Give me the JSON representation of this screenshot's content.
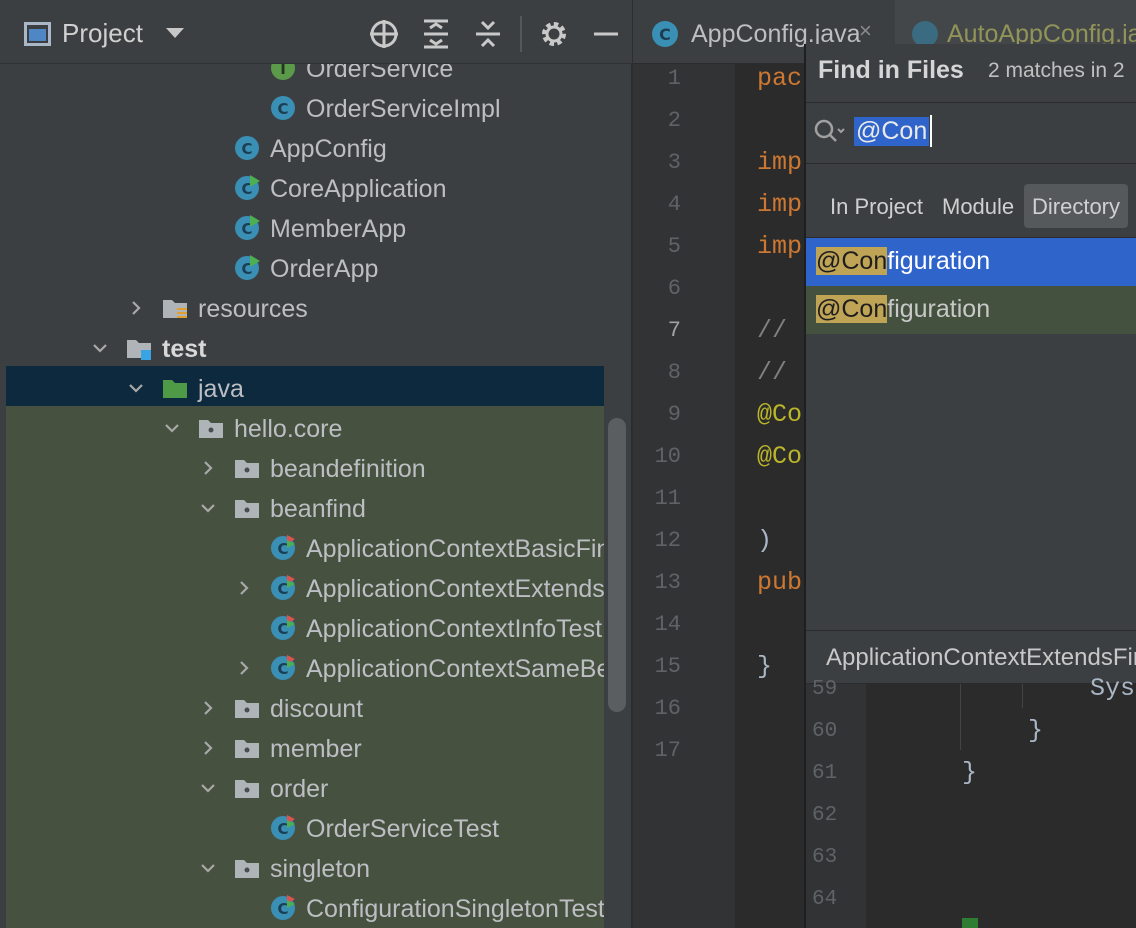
{
  "project_panel": {
    "title": "Project",
    "toolbar": {
      "icons": [
        "locate-icon",
        "expand-all-icon",
        "collapse-all-icon",
        "gear-icon",
        "minimize-icon"
      ]
    },
    "tree": [
      {
        "label": "OrderService",
        "indent": 270,
        "arrow": "none",
        "icon": "interface-icon",
        "color": "#5b9a4b"
      },
      {
        "label": "OrderServiceImpl",
        "indent": 270,
        "arrow": "none",
        "icon": "class-icon"
      },
      {
        "label": "AppConfig",
        "indent": 234,
        "arrow": "none",
        "icon": "class-icon"
      },
      {
        "label": "CoreApplication",
        "indent": 234,
        "arrow": "none",
        "icon": "runnable-class-icon"
      },
      {
        "label": "MemberApp",
        "indent": 234,
        "arrow": "none",
        "icon": "runnable-class-icon"
      },
      {
        "label": "OrderApp",
        "indent": 234,
        "arrow": "none",
        "icon": "runnable-class-icon"
      },
      {
        "label": "resources",
        "indent": 162,
        "arrow": "right",
        "icon": "resources-folder-icon"
      },
      {
        "label": "test",
        "indent": 126,
        "arrow": "down",
        "icon": "test-folder-icon",
        "bold": true
      },
      {
        "label": "java",
        "indent": 162,
        "arrow": "down",
        "icon": "test-source-folder-icon",
        "selected": true
      },
      {
        "label": "hello.core",
        "indent": 198,
        "arrow": "down",
        "icon": "package-icon"
      },
      {
        "label": "beandefinition",
        "indent": 234,
        "arrow": "right",
        "icon": "package-icon"
      },
      {
        "label": "beanfind",
        "indent": 234,
        "arrow": "down",
        "icon": "package-icon"
      },
      {
        "label": "ApplicationContextBasicFindTest",
        "indent": 270,
        "arrow": "none",
        "icon": "test-class-icon"
      },
      {
        "label": "ApplicationContextExtendsFindTest",
        "indent": 270,
        "arrow": "right",
        "icon": "test-class-icon"
      },
      {
        "label": "ApplicationContextInfoTest",
        "indent": 270,
        "arrow": "none",
        "icon": "test-class-icon"
      },
      {
        "label": "ApplicationContextSameBeanFindTest",
        "indent": 270,
        "arrow": "right",
        "icon": "test-class-icon"
      },
      {
        "label": "discount",
        "indent": 234,
        "arrow": "right",
        "icon": "package-icon"
      },
      {
        "label": "member",
        "indent": 234,
        "arrow": "right",
        "icon": "package-icon"
      },
      {
        "label": "order",
        "indent": 234,
        "arrow": "down",
        "icon": "package-icon"
      },
      {
        "label": "OrderServiceTest",
        "indent": 270,
        "arrow": "none",
        "icon": "test-class-icon"
      },
      {
        "label": "singleton",
        "indent": 234,
        "arrow": "down",
        "icon": "package-icon"
      },
      {
        "label": "ConfigurationSingletonTest",
        "indent": 270,
        "arrow": "none",
        "icon": "test-class-icon"
      }
    ]
  },
  "editor": {
    "tabs": [
      {
        "label": "AppConfig.java",
        "active": true
      },
      {
        "label": "AutoAppConfig.java",
        "active": false
      }
    ],
    "line_numbers": [
      "1",
      "2",
      "3",
      "4",
      "5",
      "6",
      "7",
      "8",
      "9",
      "10",
      "11",
      "12",
      "13",
      "14",
      "15",
      "16",
      "17"
    ],
    "current_line": "7",
    "code_lines": [
      {
        "line": "1",
        "text": "pac",
        "cls": "kw"
      },
      {
        "line": "3",
        "text": "imp",
        "cls": "kw"
      },
      {
        "line": "4",
        "text": "imp",
        "cls": "kw"
      },
      {
        "line": "5",
        "text": "imp",
        "cls": "kw"
      },
      {
        "line": "7",
        "text": "//",
        "cls": "cm"
      },
      {
        "line": "8",
        "text": "//",
        "cls": "cm"
      },
      {
        "line": "9",
        "text": "@Co",
        "cls": "an"
      },
      {
        "line": "10",
        "text": "@Co",
        "cls": "an"
      },
      {
        "line": "12",
        "text": ")",
        "cls": "pl"
      },
      {
        "line": "13",
        "text": "pub",
        "cls": "kw"
      },
      {
        "line": "15",
        "text": "}",
        "cls": "pl"
      }
    ]
  },
  "find_popup": {
    "title": "Find in Files",
    "match_count": "2 matches in 2",
    "query": "@Con",
    "scopes": [
      {
        "label": "In Project",
        "active": false
      },
      {
        "label": "Module",
        "active": false
      },
      {
        "label": "Directory",
        "active": true
      }
    ],
    "results": [
      {
        "match": "@Con",
        "rest": "figuration",
        "selected": true
      },
      {
        "match": "@Con",
        "rest": "figuration",
        "selected": false
      }
    ],
    "preview_path": "ApplicationContextExtendsFindTest",
    "preview": {
      "line_numbers": [
        "59",
        "60",
        "61",
        "62",
        "63",
        "64"
      ],
      "code": [
        {
          "line": "59",
          "text": "Sys"
        },
        {
          "line": "60",
          "text": "}"
        },
        {
          "line": "61",
          "text": "}"
        }
      ]
    }
  }
}
